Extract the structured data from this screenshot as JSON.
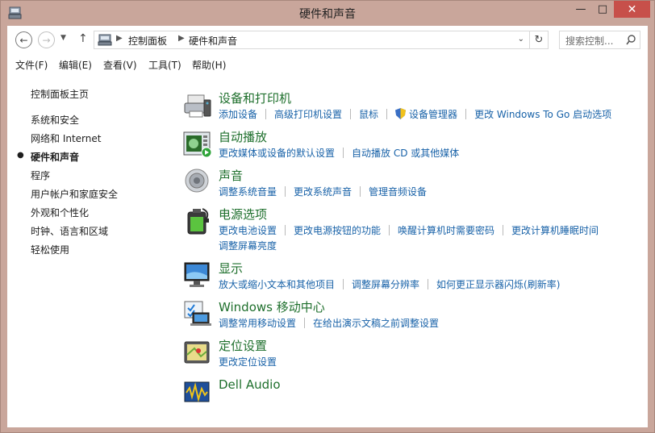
{
  "window": {
    "title": "硬件和声音"
  },
  "nav": {
    "breadcrumb": [
      "控制面板",
      "硬件和声音"
    ],
    "search_placeholder": "搜索控制..."
  },
  "menu": [
    "文件(F)",
    "编辑(E)",
    "查看(V)",
    "工具(T)",
    "帮助(H)"
  ],
  "sidebar": {
    "items": [
      {
        "label": "控制面板主页",
        "active": false
      },
      {
        "label": "系统和安全",
        "active": false
      },
      {
        "label": "网络和 Internet",
        "active": false
      },
      {
        "label": "硬件和声音",
        "active": true
      },
      {
        "label": "程序",
        "active": false
      },
      {
        "label": "用户帐户和家庭安全",
        "active": false
      },
      {
        "label": "外观和个性化",
        "active": false
      },
      {
        "label": "时钟、语言和区域",
        "active": false
      },
      {
        "label": "轻松使用",
        "active": false
      }
    ]
  },
  "categories": [
    {
      "icon": "devices-printers-icon",
      "title": "设备和打印机",
      "lines": [
        [
          "添加设备",
          "高级打印机设置",
          "鼠标",
          "设备管理器",
          "更改 Windows To Go 启动选项"
        ]
      ]
    },
    {
      "icon": "autoplay-icon",
      "title": "自动播放",
      "lines": [
        [
          "更改媒体或设备的默认设置",
          "自动播放 CD 或其他媒体"
        ]
      ]
    },
    {
      "icon": "speaker-icon",
      "title": "声音",
      "lines": [
        [
          "调整系统音量",
          "更改系统声音",
          "管理音频设备"
        ]
      ]
    },
    {
      "icon": "power-options-icon",
      "title": "电源选项",
      "lines": [
        [
          "更改电池设置",
          "更改电源按钮的功能",
          "唤醒计算机时需要密码",
          "更改计算机睡眠时间"
        ],
        [
          "调整屏幕亮度"
        ]
      ]
    },
    {
      "icon": "display-icon",
      "title": "显示",
      "lines": [
        [
          "放大或缩小文本和其他项目",
          "调整屏幕分辨率",
          "如何更正显示器闪烁(刷新率)"
        ]
      ]
    },
    {
      "icon": "mobility-center-icon",
      "title": "Windows 移动中心",
      "lines": [
        [
          "调整常用移动设置",
          "在给出演示文稿之前调整设置"
        ]
      ]
    },
    {
      "icon": "location-settings-icon",
      "title": "定位设置",
      "lines": [
        [
          "更改定位设置"
        ]
      ]
    },
    {
      "icon": "dell-audio-icon",
      "title": "Dell Audio",
      "lines": []
    }
  ],
  "colors": {
    "title_bar": "#c9a69b",
    "close_button": "#c7504a",
    "category_title": "#1e6f2c",
    "link": "#1862a8"
  }
}
